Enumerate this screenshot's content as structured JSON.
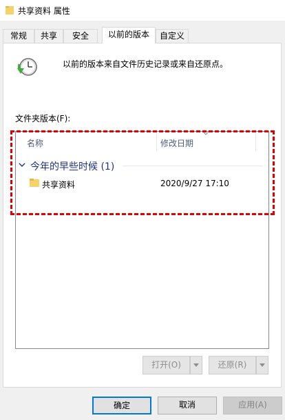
{
  "window": {
    "title": "共享资料 属性"
  },
  "tabs": [
    {
      "label": "常规",
      "active": false
    },
    {
      "label": "共享",
      "active": false
    },
    {
      "label": "安全",
      "active": false
    },
    {
      "label": "以前的版本",
      "active": true
    },
    {
      "label": "自定义",
      "active": false
    }
  ],
  "content": {
    "description": "以前的版本来自文件历史记录或来自还原点。",
    "folder_versions_label": "文件夹版本(F):"
  },
  "list": {
    "columns": [
      "名称",
      "修改日期"
    ],
    "group": {
      "label": "今年的早些时候 (1)"
    },
    "rows": [
      {
        "name": "共享资料",
        "modified": "2020/9/27 17:10"
      }
    ]
  },
  "actions": {
    "open_label": "打开(O)",
    "restore_label": "还原(R)"
  },
  "dialog_buttons": {
    "ok": "确定",
    "cancel": "取消",
    "apply": "应用(A)"
  },
  "colors": {
    "highlight": "#e00000",
    "group_header": "#1e3287",
    "column_header": "#4c607a",
    "focus": "#0078d7"
  },
  "icons": {
    "title": "folder-icon",
    "description": "restore-clock-icon",
    "row": "folder-icon"
  }
}
